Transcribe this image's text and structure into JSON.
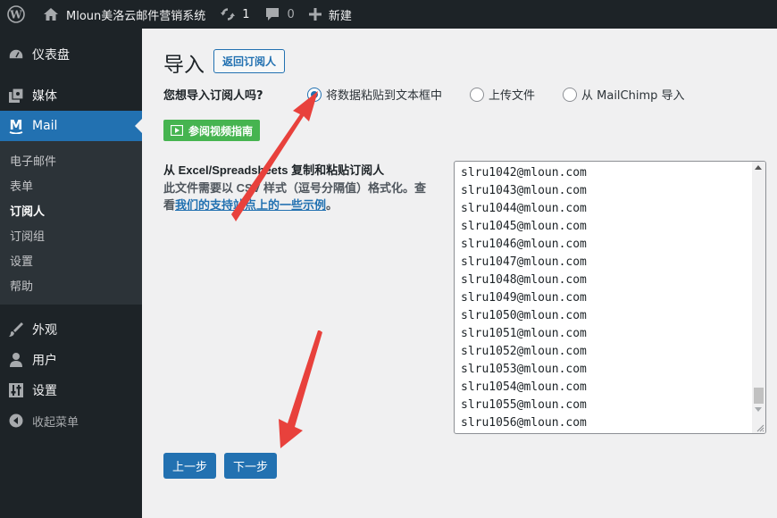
{
  "adminbar": {
    "site_name": "Mloun美洛云邮件营销系统",
    "updates_count": "1",
    "comments_count": "0",
    "new_label": "新建"
  },
  "sidebar": {
    "dashboard": "仪表盘",
    "media": "媒体",
    "mail": "Mail",
    "submenu": [
      "电子邮件",
      "表单",
      "订阅人",
      "订阅组",
      "设置",
      "帮助"
    ],
    "appearance": "外观",
    "users": "用户",
    "settings": "设置",
    "collapse": "收起菜单"
  },
  "main": {
    "title": "导入",
    "back_button": "返回订阅人",
    "question": "您想导入订阅人吗?",
    "options": [
      "将数据粘贴到文本框中",
      "上传文件",
      "从 MailChimp 导入"
    ],
    "selected_option": "将数据粘贴到文本框中",
    "video_button": "参阅视频指南",
    "desc_title": "从 Excel/Spreadsheets 复制和粘贴订阅人",
    "desc_body_prefix": "此文件需要以 CSV 样式（逗号分隔值）格式化。查看",
    "desc_link": "我们的支持站点上的一些示例",
    "desc_body_suffix": "。",
    "textarea_lines": [
      "slru1042@mloun.com",
      "slru1043@mloun.com",
      "slru1044@mloun.com",
      "slru1045@mloun.com",
      "slru1046@mloun.com",
      "slru1047@mloun.com",
      "slru1048@mloun.com",
      "slru1049@mloun.com",
      "slru1050@mloun.com",
      "slru1051@mloun.com",
      "slru1052@mloun.com",
      "slru1053@mloun.com",
      "slru1054@mloun.com",
      "slru1055@mloun.com",
      "slru1056@mloun.com"
    ],
    "prev_button": "上一步",
    "next_button": "下一步"
  },
  "colors": {
    "adminbar_bg": "#1d2327",
    "accent": "#2271b1",
    "video_green": "#46b450",
    "annotation_arrow": "#e8413c"
  }
}
